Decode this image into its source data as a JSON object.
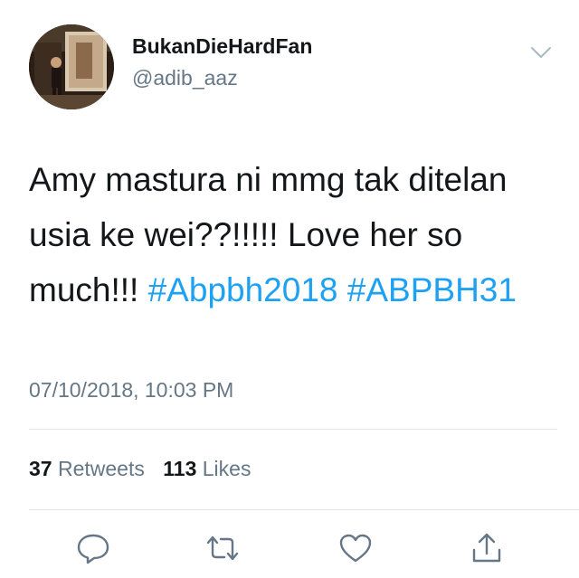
{
  "user": {
    "display_name": "BukanDieHardFan",
    "handle": "@adib_aaz"
  },
  "tweet": {
    "text_part1": "Amy mastura ni mmg tak ditelan usia ke wei??!!!!! Love her so much!!! ",
    "hashtag1": "#Abpbh2018",
    "hashtag2": "#ABPBH31",
    "timestamp": "07/10/2018, 10:03 PM"
  },
  "stats": {
    "retweets_count": "37",
    "retweets_label": "Retweets",
    "likes_count": "113",
    "likes_label": "Likes"
  },
  "icons": {
    "menu": "chevron-down-icon",
    "reply": "reply-icon",
    "retweet": "retweet-icon",
    "like": "heart-icon",
    "share": "share-icon"
  },
  "colors": {
    "hashtag": "#1da1f2",
    "secondary_text": "#657786",
    "primary_text": "#14171a",
    "divider": "#e1e8ed"
  }
}
